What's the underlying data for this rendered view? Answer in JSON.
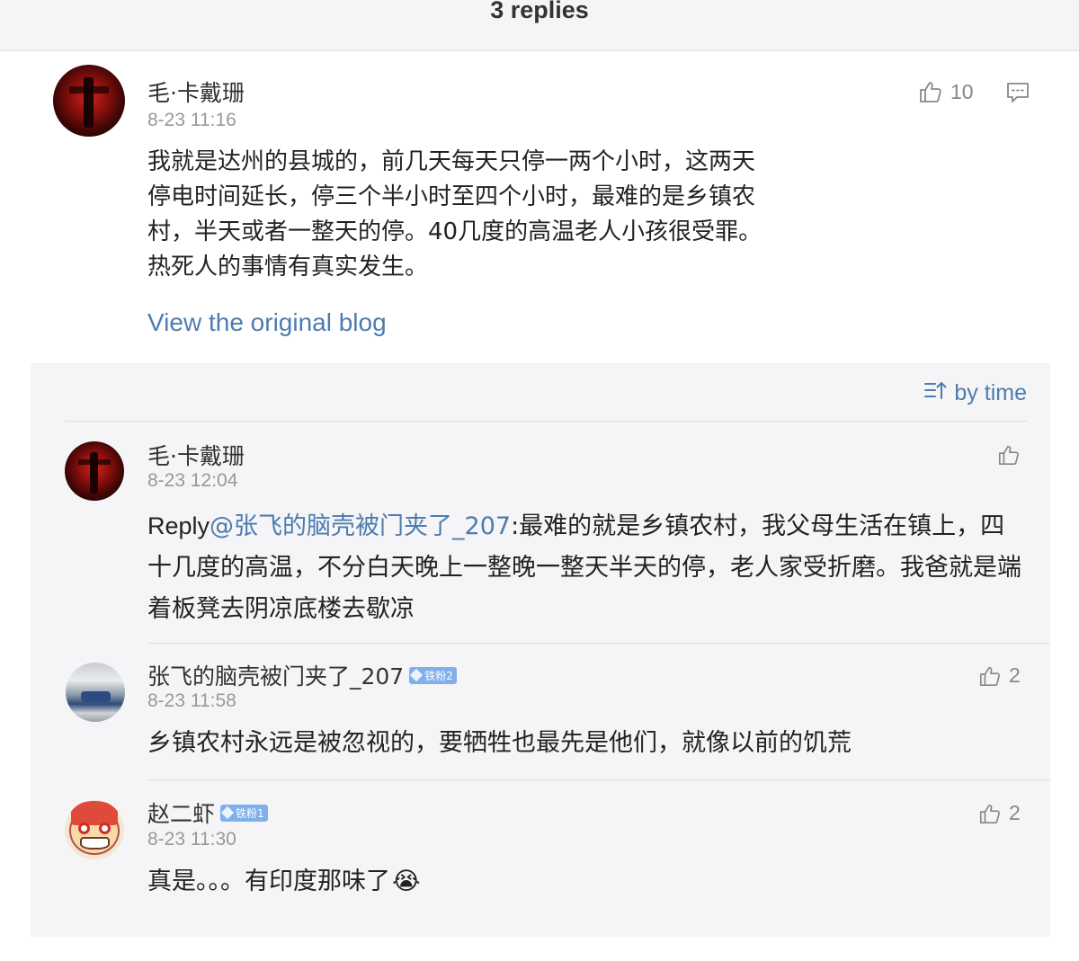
{
  "header": {
    "title": "3 replies"
  },
  "main_comment": {
    "username": "毛·卡戴珊",
    "timestamp": "8-23 11:16",
    "likes": "10",
    "text": "我就是达州的县城的，前几天每天只停一两个小时，这两天停电时间延长，停三个半小时至四个小时，最难的是乡镇农村，半天或者一整天的停。40几度的高温老人小孩很受罪。热死人的事情有真实发生。",
    "link": "View the original blog"
  },
  "replies_panel": {
    "sort_label": "by time",
    "replies": [
      {
        "username": "毛·卡戴珊",
        "timestamp": "8-23 12:04",
        "reply_prefix": "Reply",
        "mention": "@张飞的脑壳被门夹了_207",
        "text": ":最难的就是乡镇农村，我父母生活在镇上，四十几度的高温，不分白天晚上一整晚一整天半天的停，老人家受折磨。我爸就是端着板凳去阴凉底楼去歇凉"
      },
      {
        "username": "张飞的脑壳被门夹了_207",
        "badge": "铁粉2",
        "timestamp": "8-23 11:58",
        "likes": "2",
        "text": "乡镇农村永远是被忽视的，要牺牲也最先是他们，就像以前的饥荒"
      },
      {
        "username": "赵二虾",
        "badge": "铁粉1",
        "timestamp": "8-23 11:30",
        "likes": "2",
        "text": "真是。。。有印度那味了",
        "emoji": "😭"
      }
    ]
  },
  "colors": {
    "link": "#4d7cae",
    "panel_bg": "#f5f5f7",
    "badge": "#7fb0ec"
  },
  "icons": [
    "thumbs-up-icon",
    "comment-icon",
    "sort-icon",
    "crying-emoji-icon"
  ]
}
